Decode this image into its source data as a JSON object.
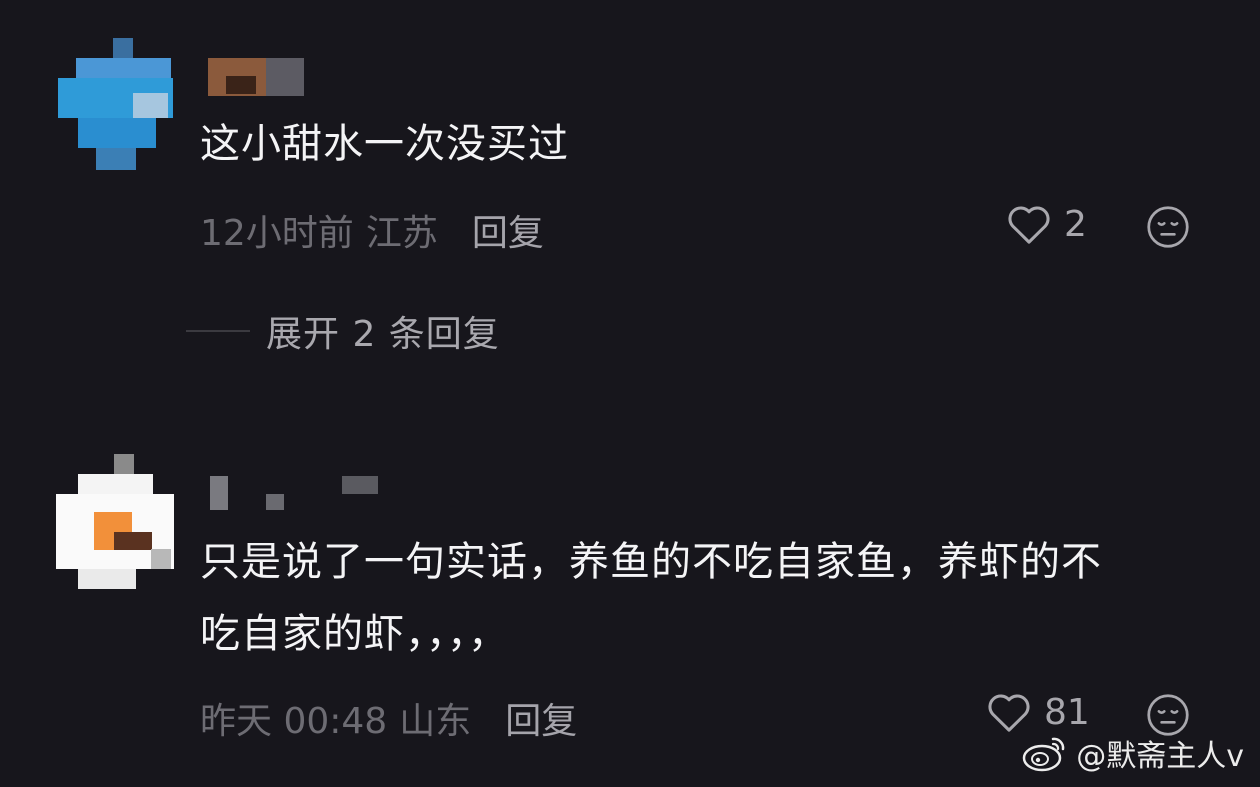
{
  "comments": [
    {
      "text": "这小甜水一次没买过",
      "time": "12小时前",
      "location": "江苏",
      "reply_label": "回复",
      "likes": "2",
      "expand_label": "展开 2 条回复"
    },
    {
      "text_line1": "只是说了一句实话，养鱼的不吃自家鱼，养虾的不",
      "text_line2": "吃自家的虾，，，，",
      "time": "昨天 00:48",
      "location": "山东",
      "reply_label": "回复",
      "likes": "81"
    }
  ],
  "watermark": "@默斋主人v",
  "icons": {
    "like": "heart-outline-icon",
    "dislike": "neutral-face-icon",
    "watermark": "weibo-logo-icon"
  },
  "colors": {
    "background": "#17161c",
    "text": "#f4f4f6",
    "meta": "#6d6c73"
  }
}
